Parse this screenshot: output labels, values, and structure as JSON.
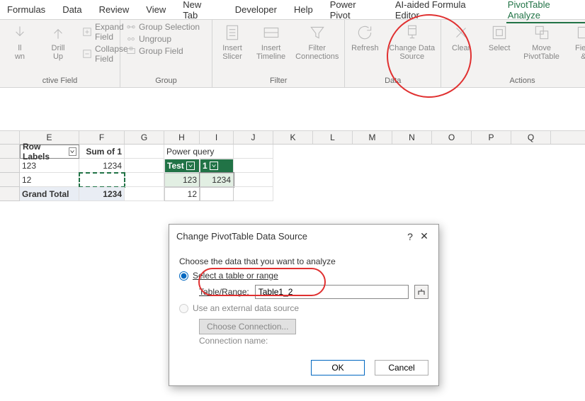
{
  "tabs": [
    "Formulas",
    "Data",
    "Review",
    "View",
    "New Tab",
    "Developer",
    "Help",
    "Power Pivot",
    "AI-aided Formula Editor",
    "PivotTable Analyze"
  ],
  "activeTab": "PivotTable Analyze",
  "ribbon": {
    "activeField": {
      "label": "ctive Field",
      "drillDown": "ll\nwn",
      "drillUp": "Drill\nUp",
      "expand": "Expand Field",
      "collapse": "Collapse Field"
    },
    "group": {
      "label": "Group",
      "selection": "Group Selection",
      "ungroup": "Ungroup",
      "field": "Group Field"
    },
    "filter": {
      "label": "Filter",
      "slicer": "Insert\nSlicer",
      "timeline": "Insert\nTimeline",
      "connections": "Filter\nConnections"
    },
    "data": {
      "label": "Data",
      "refresh": "Refresh",
      "changeSource": "Change Data\nSource"
    },
    "actions": {
      "label": "Actions",
      "clear": "Clear",
      "select": "Select",
      "move": "Move\nPivotTable",
      "field": "Field\n&"
    }
  },
  "columns": [
    "",
    "E",
    "F",
    "G",
    "H",
    "I",
    "J",
    "K",
    "L",
    "M",
    "N",
    "O",
    "P",
    "Q"
  ],
  "pivot": {
    "rowLabels": "Row Labels",
    "sumOf": "Sum of 1",
    "rows": [
      {
        "label": "123",
        "val": "1234"
      },
      {
        "label": "12",
        "val": ""
      }
    ],
    "grandTotal": "Grand Total",
    "grandVal": "1234"
  },
  "pq": {
    "title": "Power query",
    "h1": "Test",
    "h2": "1",
    "rows": [
      {
        "a": "123",
        "b": "1234"
      },
      {
        "a": "12",
        "b": ""
      }
    ]
  },
  "dialog": {
    "title": "Change PivotTable Data Source",
    "choose": "Choose the data that you want to analyze",
    "opt1": "Select a table or range",
    "rangeLabel": "Table/Range:",
    "rangeValue": "Table1_2",
    "opt2": "Use an external data source",
    "chooseConn": "Choose Connection...",
    "connName": "Connection name:",
    "ok": "OK",
    "cancel": "Cancel"
  }
}
